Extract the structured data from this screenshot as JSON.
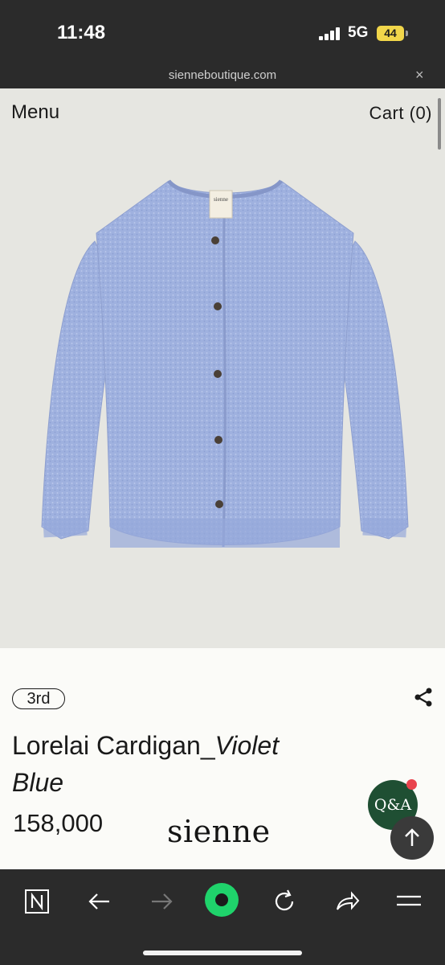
{
  "status_bar": {
    "time": "11:48",
    "network": "5G",
    "battery": "44"
  },
  "browser": {
    "url": "sienneboutique.com",
    "close_label": "×"
  },
  "header": {
    "menu_label": "Menu",
    "cart_label": "Cart (0)"
  },
  "product": {
    "image_icon": "cardigan-photo",
    "tag_label": "sienne",
    "rank_badge": "3rd",
    "title_main": "Lorelai Cardigan_",
    "title_italic": "Violet Blue",
    "price": "158,000"
  },
  "brand": {
    "logo_text": "sienne"
  },
  "floating": {
    "qa_label": "Q&A",
    "top_icon": "arrow-up-icon"
  },
  "bottom_nav": {
    "items": [
      "n-logo-icon",
      "back-arrow-icon",
      "forward-arrow-icon",
      "green-circle-icon",
      "refresh-icon",
      "share-arrow-icon",
      "menu-icon"
    ]
  },
  "colors": {
    "status_bar_bg": "#2b2b2b",
    "hero_bg": "#e6e6e1",
    "cardigan": "#9fb1df",
    "qa_green": "#1f4f33",
    "accent_green": "#1fd36b",
    "badge_red": "#e9434d"
  }
}
